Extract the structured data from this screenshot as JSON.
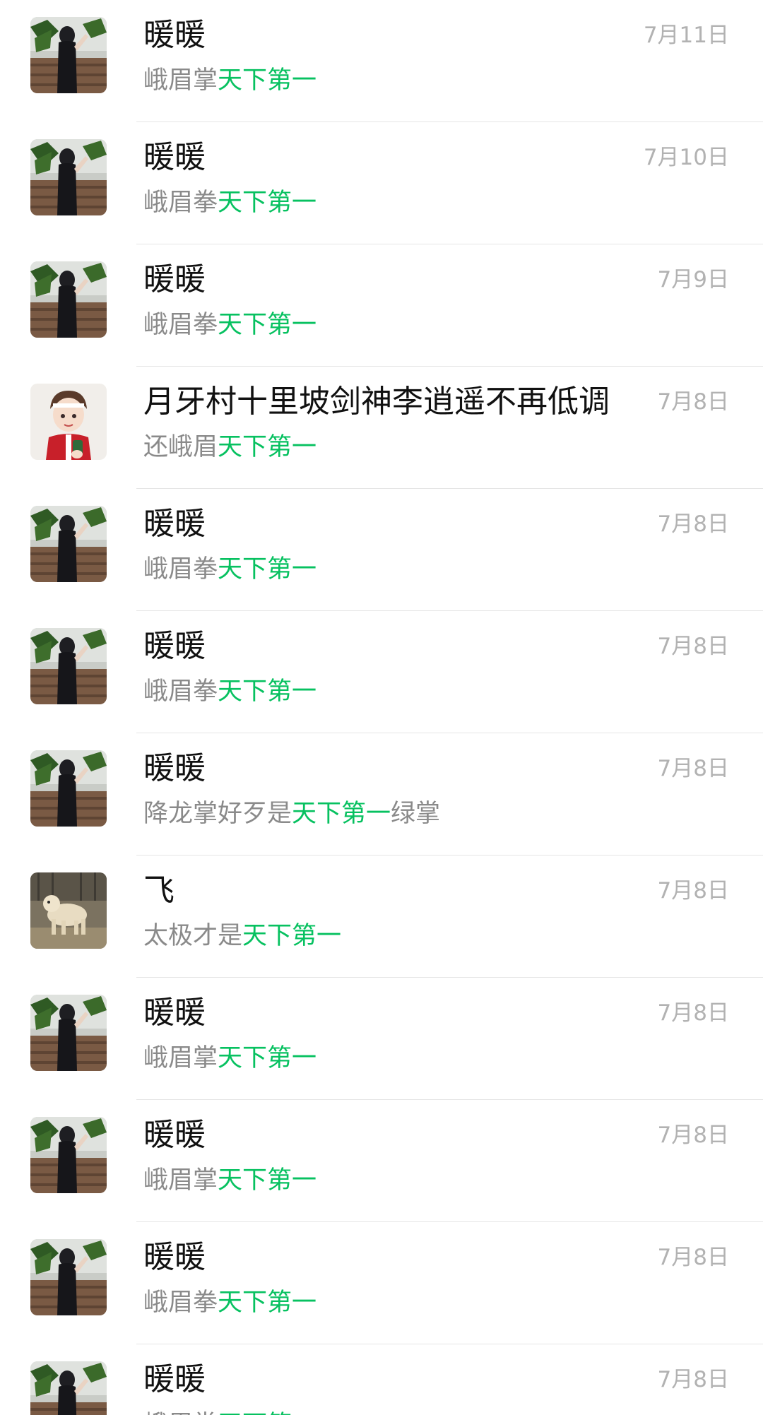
{
  "chats": [
    {
      "avatar": "photo-girl",
      "name": "暖暖",
      "date": "7月11日",
      "pre": "峨眉掌",
      "highlight": "天下第一",
      "post": ""
    },
    {
      "avatar": "photo-girl",
      "name": "暖暖",
      "date": "7月10日",
      "pre": "峨眉拳",
      "highlight": "天下第一",
      "post": ""
    },
    {
      "avatar": "photo-girl",
      "name": "暖暖",
      "date": "7月9日",
      "pre": "峨眉拳",
      "highlight": "天下第一",
      "post": ""
    },
    {
      "avatar": "cartoon-boy",
      "name": "月牙村十里坡剑神李逍遥不再低调",
      "date": "7月8日",
      "pre": "还峨眉",
      "highlight": "天下第一",
      "post": ""
    },
    {
      "avatar": "photo-girl",
      "name": "暖暖",
      "date": "7月8日",
      "pre": "峨眉拳",
      "highlight": "天下第一",
      "post": ""
    },
    {
      "avatar": "photo-girl",
      "name": "暖暖",
      "date": "7月8日",
      "pre": "峨眉拳",
      "highlight": "天下第一",
      "post": ""
    },
    {
      "avatar": "photo-girl",
      "name": "暖暖",
      "date": "7月8日",
      "pre": "降龙掌好歹是",
      "highlight": "天下第一",
      "post": "绿掌"
    },
    {
      "avatar": "dog-photo",
      "name": "飞",
      "date": "7月8日",
      "pre": "太极才是",
      "highlight": "天下第一",
      "post": ""
    },
    {
      "avatar": "photo-girl",
      "name": "暖暖",
      "date": "7月8日",
      "pre": "峨眉掌",
      "highlight": "天下第一",
      "post": ""
    },
    {
      "avatar": "photo-girl",
      "name": "暖暖",
      "date": "7月8日",
      "pre": "峨眉掌",
      "highlight": "天下第一",
      "post": ""
    },
    {
      "avatar": "photo-girl",
      "name": "暖暖",
      "date": "7月8日",
      "pre": "峨眉拳",
      "highlight": "天下第一",
      "post": ""
    },
    {
      "avatar": "photo-girl",
      "name": "暖暖",
      "date": "7月8日",
      "pre": "峨眉掌",
      "highlight": "天下第一",
      "post": ""
    }
  ],
  "colors": {
    "highlight": "#07c160",
    "preview": "#8a8a8a",
    "date": "#b2b2b2",
    "name": "#111111"
  }
}
